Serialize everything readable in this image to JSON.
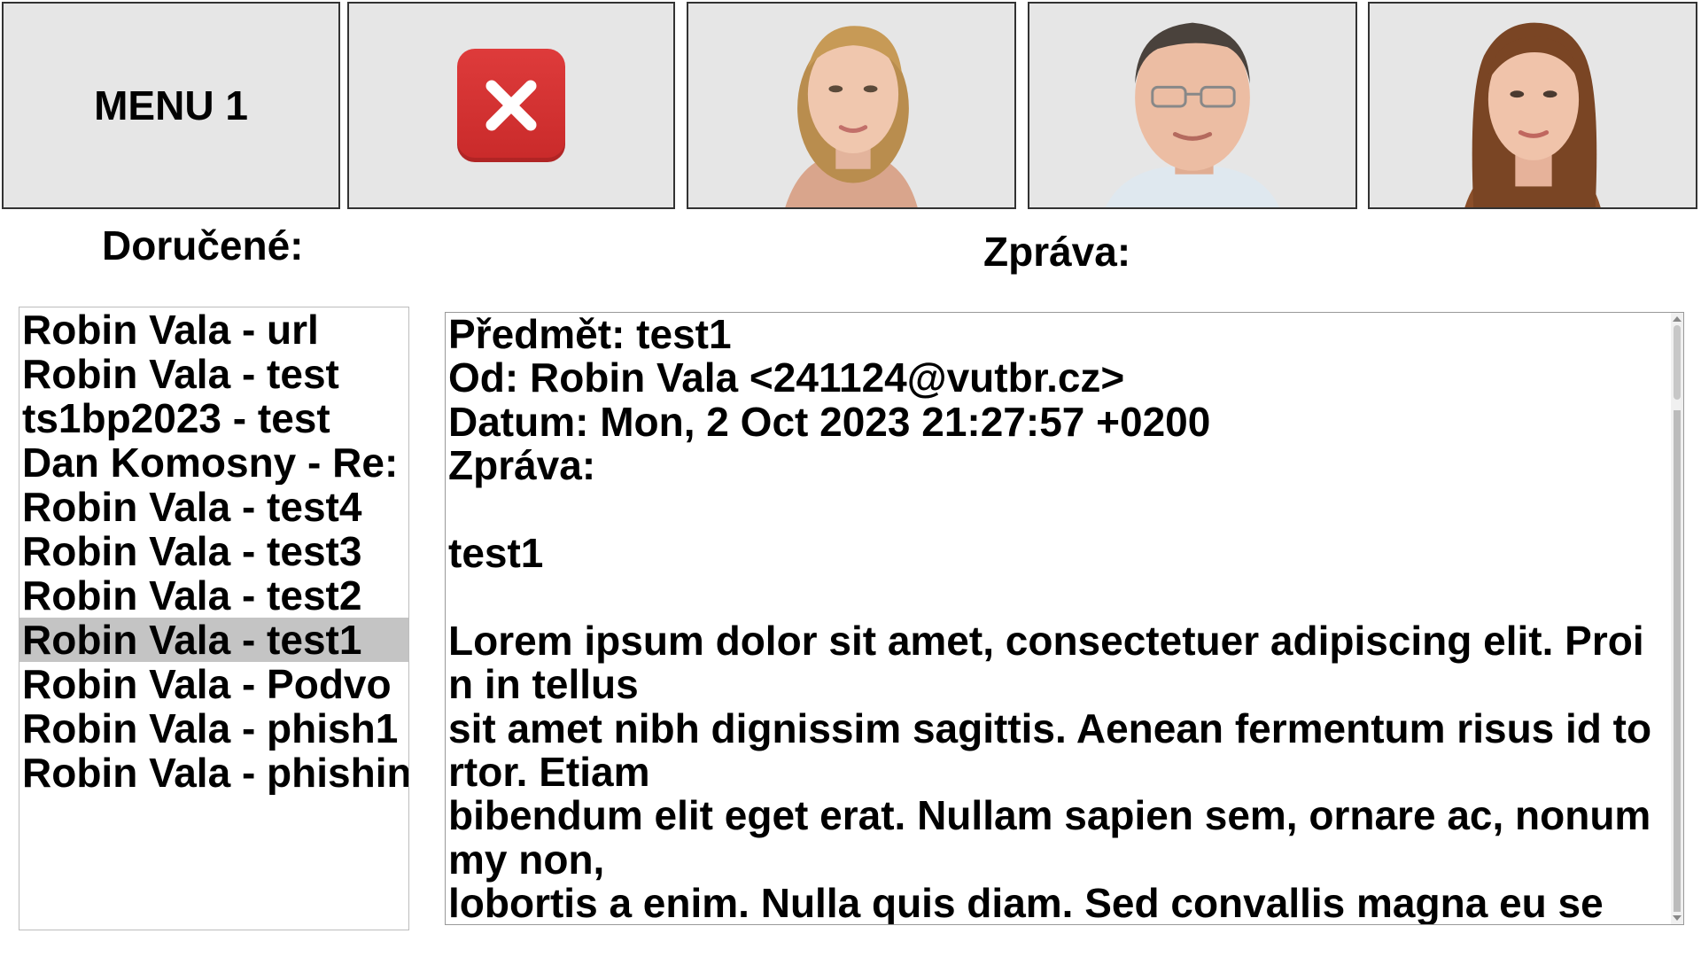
{
  "toolbar": {
    "menu_label": "MENU 1"
  },
  "labels": {
    "inbox": "Doručené:",
    "message": "Zpráva:"
  },
  "inbox": {
    "items": [
      {
        "text": "Robin Vala - url"
      },
      {
        "text": "Robin Vala - test"
      },
      {
        "text": "ts1bp2023 - test"
      },
      {
        "text": "Dan Komosny - Re: "
      },
      {
        "text": "Robin Vala - test4"
      },
      {
        "text": "Robin Vala - test3"
      },
      {
        "text": "Robin Vala - test2"
      },
      {
        "text": "Robin Vala - test1"
      },
      {
        "text": "Robin Vala - Podvo"
      },
      {
        "text": "Robin Vala - phish1"
      },
      {
        "text": "Robin Vala - phishin"
      }
    ],
    "selected_index": 7
  },
  "message": {
    "body": "Předmět: test1\nOd: Robin Vala <241124@vutbr.cz>\nDatum: Mon, 2 Oct 2023 21:27:57 +0200\nZpráva:\n\ntest1\n\nLorem ipsum dolor sit amet, consectetuer adipiscing elit. Proin in tellus\nsit amet nibh dignissim sagittis. Aenean fermentum risus id tortor. Etiam\nbibendum elit eget erat. Nullam sapien sem, ornare ac, nonummy non,\nlobortis a enim. Nulla quis diam. Sed convallis magna eu se"
  },
  "colors": {
    "tile_bg": "#e6e6e6",
    "close_red": "#d33232",
    "selected_row": "#c4c4c4"
  }
}
